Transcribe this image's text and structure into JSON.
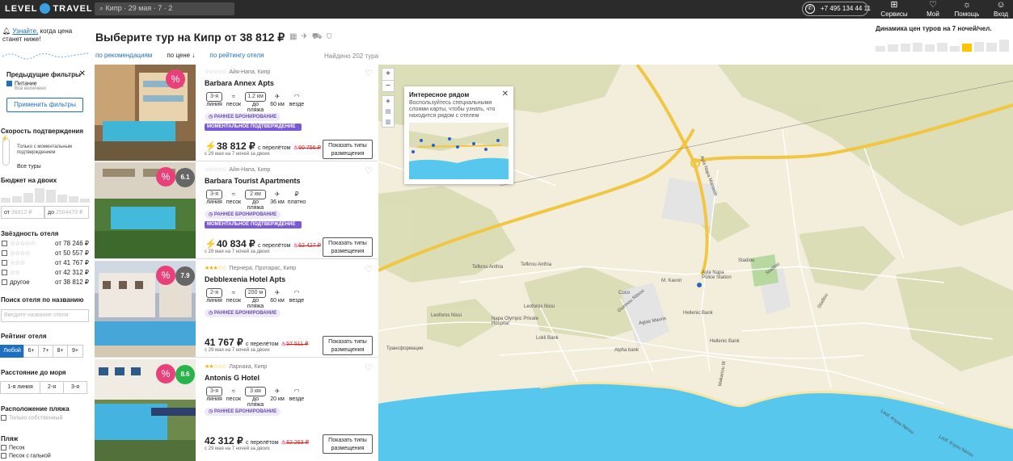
{
  "topbar": {
    "logo_left": "LEVEL",
    "logo_right": "TRAVEL",
    "search": "Кипр · 29 мая · 7 · 2",
    "phone": "+7 495 134 44 11",
    "buttons": [
      {
        "label": "Сервисы",
        "icon": "grid-icon"
      },
      {
        "label": "Мой список",
        "icon": "heart-icon"
      },
      {
        "label": "Помощь",
        "icon": "bulb-icon"
      },
      {
        "label": "Вход",
        "icon": "user-icon"
      }
    ]
  },
  "alert": {
    "link": "Узнайте,",
    "rest": " когда цена станет ниже!"
  },
  "page_title": "Выберите тур на Кипр от 38 812 ₽",
  "dynamics": {
    "title": "Динамика цен туров на 7 ночей/чел.",
    "bars": [
      0.3,
      0.4,
      0.45,
      0.5,
      0.4,
      0.5,
      0.3,
      0.45,
      0.55,
      0.5,
      0.7
    ]
  },
  "sort": {
    "recommend": "по рекомендациям",
    "price": "по цене ↓",
    "rating": "по рейтингу отеля"
  },
  "found": "Найдено 202 тура",
  "sidebar": {
    "prev_filters": "Предыдущие фильтры",
    "food": "Питание",
    "food_sub": "Всё включено",
    "apply": "Применить фильтры",
    "speed_title": "Скорость подтверждения",
    "speed_opt1": "Только с моментальным подтверждением",
    "speed_opt2": "Все туры",
    "budget_title": "Бюджет на двоих",
    "budget_from_label": "от",
    "budget_from": "38812 ₽",
    "budget_to_label": "до",
    "budget_to": "2504470 ₽",
    "stars_title": "Звёздность отеля",
    "stars": [
      {
        "stars": "☆☆☆☆☆",
        "price": "от 78 246 ₽"
      },
      {
        "stars": "☆☆☆☆",
        "price": "от 50 557 ₽"
      },
      {
        "stars": "☆☆☆",
        "price": "от 41 767 ₽"
      },
      {
        "stars": "☆☆",
        "price": "от 42 312 ₽"
      },
      {
        "stars": "другое",
        "price": "от 38 812 ₽"
      }
    ],
    "hotel_search_title": "Поиск отеля по названию",
    "hotel_search_ph": "Введите название отеля",
    "rating_title": "Рейтинг отеля",
    "rating_opts": [
      "Любой",
      "6+",
      "7+",
      "8+",
      "9+"
    ],
    "sea_title": "Расстояние до моря",
    "sea_opts": [
      "1-я линия",
      "2-я",
      "3-я"
    ],
    "beach_loc_title": "Расположение пляжа",
    "beach_loc_opt": "Только собственный",
    "beach_title": "Пляж",
    "beach_opts": [
      "Песок",
      "Песок с галькой"
    ]
  },
  "hotels": [
    {
      "stars": "☆☆☆☆☆",
      "loc": "Айя-Напа, Кипр",
      "name": "Barbara Annex Apts",
      "rating": "",
      "line": "3-я",
      "dist": "1.2 км",
      "airport": "60 км",
      "wifi": "везде",
      "early": "РАННЕЕ БРОНИРОВАНИЕ",
      "instant": "МОМЕНТАЛЬНОЕ ПОДТВЕРЖДЕНИЕ",
      "price": "38 812 ₽",
      "with": "с перелётом",
      "old": "60 756 ₽",
      "desc": "с 29 мая на 7 ночей за двоих"
    },
    {
      "stars": "☆☆☆☆☆",
      "loc": "Айя-Напа, Кипр",
      "name": "Barbara Tourist Apartments",
      "rating": "6.1",
      "line": "3-я",
      "dist": "2 км",
      "airport": "36 км",
      "wifi": "платно",
      "early": "РАННЕЕ БРОНИРОВАНИЕ",
      "instant": "МОМЕНТАЛЬНОЕ ПОДТВЕРЖДЕНИЕ",
      "price": "40 834 ₽",
      "with": "с перелётом",
      "old": "62 427 ₽",
      "desc": "с 29 мая на 7 ночей за двоих"
    },
    {
      "stars": "★★★☆☆",
      "loc": "Пернера, Протарас, Кипр",
      "name": "Debblexenia Hotel Apts",
      "rating": "7.9",
      "line": "2-я",
      "dist": "200 м",
      "airport": "60 км",
      "wifi": "везде",
      "early": "РАННЕЕ БРОНИРОВАНИЕ",
      "instant": "",
      "price": "41 767 ₽",
      "with": "с перелётом",
      "old": "57 511 ₽",
      "desc": "с 29 мая на 7 ночей за двоих"
    },
    {
      "stars": "★★☆☆☆",
      "loc": "Ларнака, Кипр",
      "name": "Antonis G Hotel",
      "rating": "8.6",
      "line": "3-я",
      "dist": "3 км",
      "airport": "20 км",
      "wifi": "везде",
      "early": "РАННЕЕ БРОНИРОВАНИЕ",
      "instant": "",
      "price": "42 312 ₽",
      "with": "с перелётом",
      "old": "62 263 ₽",
      "desc": "с 29 мая на 7 ночей за двоих"
    }
  ],
  "feat_labels": {
    "line": "линия",
    "sand": "песок",
    "beach": "до пляжа",
    "air": "60 км",
    "wifi": ""
  },
  "show_btn": "Показать типы размещения",
  "map": {
    "popup_title": "Интересное рядом",
    "popup_text": "Воспользуйтесь специальными слоями карты, чтобы узнать, что находится рядом с отелем",
    "labels": [
      "Tefkrou Anthia",
      "Tefkrou Anthia",
      "M. Kavon",
      "Coco",
      "Napa Olympic Private Hospital",
      "Lokli Bank",
      "Alpha bank",
      "Hellenic Bank",
      "Hellenic Bank",
      "Трансформации",
      "Leoforos Nissi",
      "Leoforos Nissi",
      "Giannou Ritsou",
      "Agias Mavris",
      "Stadiou",
      "Stadiou",
      "Stadiou",
      "Makariou III",
      "Leof. Kryou Nerou",
      "Leof. Kryou Nerou",
      "Ayia Napa Police Station",
      "Ayia Napa Manastir"
    ]
  }
}
